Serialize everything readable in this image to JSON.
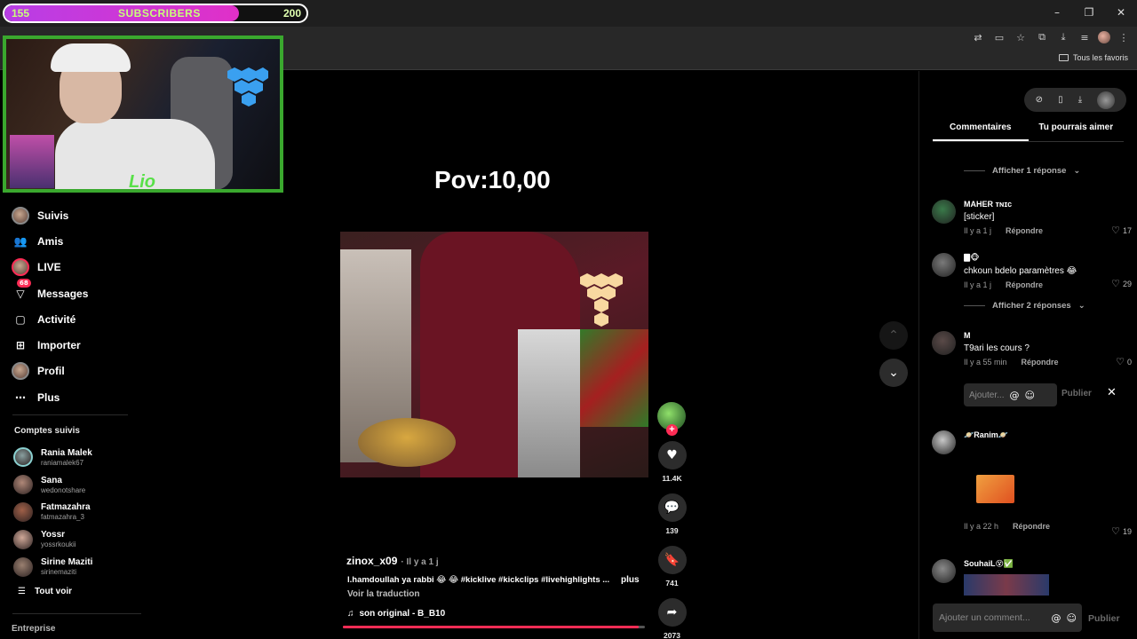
{
  "window": {
    "min": "–",
    "restore": "❐",
    "close": "✕"
  },
  "toolbar_icons": [
    "translate-icon",
    "screen-icon",
    "star-icon",
    "extensions-icon",
    "download-icon",
    "media-icon",
    "profile-avatar",
    "menu-icon"
  ],
  "bookmarks": {
    "favorites_label": "Tous les favoris"
  },
  "overlay": {
    "subs_current": "155",
    "subs_label": "SUBSCRIBERS",
    "subs_goal": "200",
    "subs_progress": 0.775,
    "webcam_logo": "Lio"
  },
  "nav": [
    {
      "name": "suivis",
      "label": "Suivis",
      "icon": "avatar"
    },
    {
      "name": "amis",
      "label": "Amis",
      "icon": "friends-icon",
      "glyph": "👥"
    },
    {
      "name": "live",
      "label": "LIVE",
      "icon": "avatar"
    },
    {
      "name": "messages",
      "label": "Messages",
      "icon": "messages-icon",
      "glyph": "▽",
      "badge": "68"
    },
    {
      "name": "activite",
      "label": "Activité",
      "icon": "activity-icon",
      "glyph": "▢"
    },
    {
      "name": "importer",
      "label": "Importer",
      "icon": "upload-icon",
      "glyph": "⊞"
    },
    {
      "name": "profil",
      "label": "Profil",
      "icon": "avatar"
    },
    {
      "name": "plus",
      "label": "Plus",
      "icon": "more-icon",
      "glyph": "⋯"
    }
  ],
  "following": {
    "title": "Comptes suivis",
    "accounts": [
      {
        "name": "Rania Malek",
        "user": "raniamalek67",
        "color": "#8aa0a0"
      },
      {
        "name": "Sana",
        "user": "wedonotshare",
        "color": "#b08878"
      },
      {
        "name": "Fatmazahra",
        "user": "fatmazahra_3",
        "color": "#a06048"
      },
      {
        "name": "Yossr",
        "user": "yossrkoukii",
        "color": "#d0a898"
      },
      {
        "name": "Sirine Maziti",
        "user": "sirinemaziti",
        "color": "#9a8070"
      }
    ],
    "see_all": "Tout voir"
  },
  "footer": {
    "entreprise": "Entreprise"
  },
  "video": {
    "overlay_text": "Pov:10,00",
    "author": "zinox_x09",
    "time": "· Il y a 1 j",
    "caption": "l.hamdoullah ya rabbi 😂 😂 #kicklive #kickclips #livehighlights ...",
    "more": "plus",
    "translate": "Voir la traduction",
    "sound_icon": "♫",
    "sound": "son original - B_B10",
    "progress": 0.98
  },
  "actions": [
    {
      "name": "like",
      "glyph": "♥",
      "count": "11.4K"
    },
    {
      "name": "comment",
      "glyph": "💬",
      "count": "139"
    },
    {
      "name": "bookmark",
      "glyph": "🔖",
      "count": "741"
    },
    {
      "name": "share",
      "glyph": "➦",
      "count": "2073"
    }
  ],
  "arrows": {
    "up": "⌃",
    "down": "⌄"
  },
  "panel": {
    "tabs": [
      "Commentaires",
      "Tu pourrais aimer"
    ],
    "tool_glyphs": [
      "⊘",
      "▯",
      "⤓"
    ],
    "show_1": "Afficher 1 réponse",
    "show_2": "Afficher 2 réponses",
    "comments": [
      {
        "name": "MAHER ᴛɴɪᴄ",
        "text": "[sticker]",
        "time": "Il y a 1 j",
        "reply": "Répondre",
        "likes": "17",
        "color": "#3a7a4a"
      },
      {
        "name": "🀫🐵",
        "text": "chkoun bdelo paramètres 😂",
        "time": "Il y a 1 j",
        "reply": "Répondre",
        "likes": "29",
        "color": "#7a7a7a"
      },
      {
        "name": "M",
        "text": "T9ari les cours ?",
        "time": "Il y a 55 min",
        "reply": "Répondre",
        "likes": "0",
        "color": "#5a4a48"
      },
      {
        "name": "🪐Ranim🪐",
        "text": "",
        "time": "Il y a 22 h",
        "reply": "Répondre",
        "likes": "19",
        "color": "#c8c8c8"
      },
      {
        "name": "SouhaiL😵✅",
        "text": "",
        "time": "",
        "reply": "",
        "likes": "",
        "color": "#8a8a8a"
      }
    ],
    "reply_placeholder": "Ajouter...",
    "reply_at": "@",
    "reply_emoji": "☺",
    "reply_publish": "Publier",
    "reply_close": "✕",
    "add_placeholder": "Ajouter un comment...",
    "add_publish": "Publier"
  }
}
